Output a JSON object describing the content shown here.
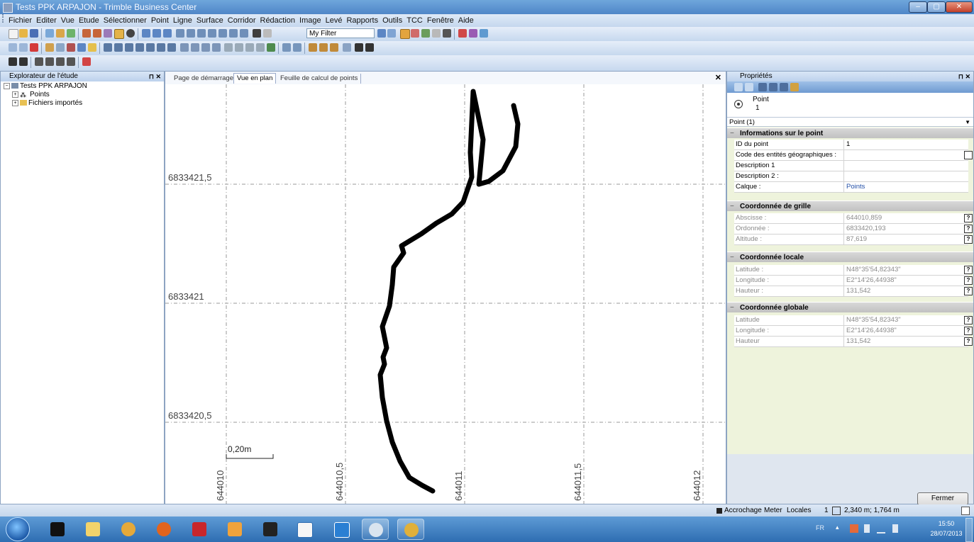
{
  "window": {
    "title": "Tests PPK ARPAJON - Trimble Business Center",
    "minimize": "–",
    "maximize": "▢",
    "close": "✕"
  },
  "menu": [
    "Fichier",
    "Editer",
    "Vue",
    "Etude",
    "Sélectionner",
    "Point",
    "Ligne",
    "Surface",
    "Corridor",
    "Rédaction",
    "Image",
    "Levé",
    "Rapports",
    "Outils",
    "TCC",
    "Fenêtre",
    "Aide"
  ],
  "toolbar": {
    "filter_value": "My Filter"
  },
  "explorer": {
    "title": "Explorateur de l'étude",
    "pin": "⊓ ✕",
    "project": "Tests PPK ARPAJON",
    "items": [
      "Points",
      "Fichiers importés"
    ]
  },
  "document": {
    "tabs": [
      "Page de démarrage",
      "Vue en plan",
      "Feuille de calcul de points"
    ],
    "active_tab": "Vue en plan",
    "close": "✕",
    "y_labels": [
      "6833421,5",
      "6833421",
      "6833420,5"
    ],
    "x_labels": [
      "644010",
      "644010,5",
      "644011",
      "644011,5",
      "644012"
    ],
    "scale_label": "0,20m"
  },
  "properties": {
    "title": "Propriétés",
    "pin": "⊓ ✕",
    "point_label": "Point",
    "point_number": "1",
    "selector": "Point (1)",
    "sections": {
      "info": {
        "title": "Informations sur le point",
        "rows": [
          {
            "label": "ID du point",
            "value": "1"
          },
          {
            "label": "Code des entités géographiques :",
            "value": ""
          },
          {
            "label": "Description 1",
            "value": ""
          },
          {
            "label": "Description 2 :",
            "value": ""
          },
          {
            "label": "Calque :",
            "value": "Points"
          }
        ]
      },
      "grid": {
        "title": "Coordonnée de grille",
        "rows": [
          {
            "label": "Abscisse :",
            "value": "644010,859"
          },
          {
            "label": "Ordonnée :",
            "value": "6833420,193"
          },
          {
            "label": "Altitude :",
            "value": "87,619"
          }
        ]
      },
      "local": {
        "title": "Coordonnée locale",
        "rows": [
          {
            "label": "Latitude :",
            "value": "N48°35'54,82343\""
          },
          {
            "label": "Longitude :",
            "value": "E2°14'26,44938\""
          },
          {
            "label": "Hauteur :",
            "value": "131,542"
          }
        ]
      },
      "global": {
        "title": "Coordonnée globale",
        "rows": [
          {
            "label": "Latitude",
            "value": "N48°35'54,82343\""
          },
          {
            "label": "Longitude :",
            "value": "E2°14'26,44938\""
          },
          {
            "label": "Hauteur",
            "value": "131,542"
          }
        ]
      }
    },
    "close_button": "Fermer"
  },
  "statusbar": {
    "snap": "Accrochage",
    "units": "Meter",
    "local": "Locales",
    "count": "1",
    "dimensions": "2,340 m; 1,764 m"
  },
  "taskbar": {
    "lang": "FR",
    "time": "15:50",
    "date": "28/07/2013"
  }
}
